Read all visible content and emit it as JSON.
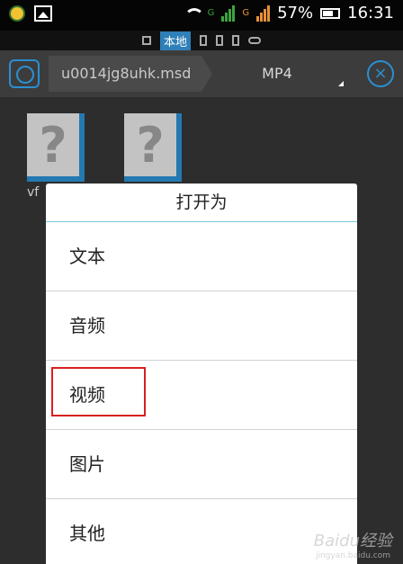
{
  "status_bar": {
    "battery_text": "57%",
    "time": "16:31",
    "signal1_label": "G",
    "signal2_label": "G"
  },
  "mode_bar": {
    "active_label": "本地"
  },
  "toolbar": {
    "path_text": "u0014jg8uhk.msd",
    "type_text": "MP4"
  },
  "files": {
    "items": [
      {
        "glyph": "?"
      },
      {
        "glyph": "?"
      }
    ],
    "partial_label": "vf"
  },
  "dialog": {
    "title": "打开为",
    "items": [
      {
        "label": "文本"
      },
      {
        "label": "音频"
      },
      {
        "label": "视频"
      },
      {
        "label": "图片"
      },
      {
        "label": "其他"
      }
    ]
  },
  "watermark": {
    "text": "Baidu经验",
    "subtext": "jingyan.baidu.com"
  }
}
